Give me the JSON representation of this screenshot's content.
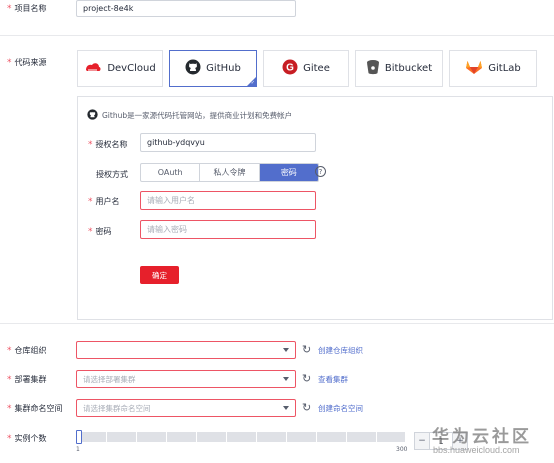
{
  "project_name": {
    "label": "项目名称",
    "value": "project-8e4k"
  },
  "code_source": {
    "label": "代码来源",
    "options": [
      {
        "name": "DevCloud",
        "icon": "devcloud-icon",
        "color": "#e6202b"
      },
      {
        "name": "GitHub",
        "icon": "github-icon",
        "color": "#24292e",
        "selected": true
      },
      {
        "name": "Gitee",
        "icon": "gitee-icon",
        "color": "#c71d23"
      },
      {
        "name": "Bitbucket",
        "icon": "bitbucket-icon",
        "color": "#333333"
      },
      {
        "name": "GitLab",
        "icon": "gitlab-icon",
        "color": "#fc6d26"
      }
    ]
  },
  "github_panel": {
    "description": "Github是一家源代码托管网站，提供商业计划和免费帐户",
    "auth_name_label": "授权名称",
    "auth_name_value": "github-ydqvyu",
    "auth_method_label": "授权方式",
    "auth_methods": [
      "OAuth",
      "私人令牌",
      "密码"
    ],
    "auth_method_selected": "密码",
    "username_label": "用户名",
    "username_placeholder": "请输入用户名",
    "password_label": "密码",
    "password_placeholder": "请输入密码",
    "confirm_label": "确定"
  },
  "repo_org": {
    "label": "仓库组织",
    "placeholder": "",
    "link": "创建仓库组织"
  },
  "cluster": {
    "label": "部署集群",
    "placeholder": "请选择部署集群",
    "link": "查看集群"
  },
  "namespace": {
    "label": "集群命名空间",
    "placeholder": "请选择集群命名空间",
    "link": "创建命名空间"
  },
  "instances": {
    "label": "实例个数",
    "min": "1",
    "max": "300",
    "value": "1",
    "minus": "−",
    "plus": "+"
  },
  "watermark": {
    "title": "华为云社区",
    "url": "bbs.huaweicloud.com"
  },
  "colors": {
    "accent": "#526ecc",
    "required": "#ed5565",
    "primary_button": "#e6202b"
  }
}
